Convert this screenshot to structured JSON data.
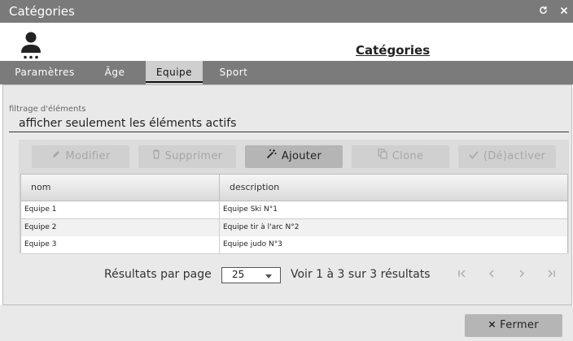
{
  "window": {
    "title": "Catégories",
    "refresh_icon": "refresh-icon",
    "close_icon": "close-icon"
  },
  "header": {
    "heading": "Catégories",
    "avatar_icon": "user-avatar-icon"
  },
  "tabs": [
    {
      "label": "Paramètres"
    },
    {
      "label": "Âge"
    },
    {
      "label": "Equipe",
      "active": true
    },
    {
      "label": "Sport"
    }
  ],
  "filter": {
    "label": "filtrage d'éléments",
    "value": "afficher seulement les éléments actifs"
  },
  "toolbar": {
    "modify": {
      "label": "Modifier",
      "icon": "pencil-icon",
      "enabled": false
    },
    "delete": {
      "label": "Supprimer",
      "icon": "trash-icon",
      "enabled": false
    },
    "add": {
      "label": "Ajouter",
      "icon": "magic-wand-icon",
      "enabled": true
    },
    "clone": {
      "label": "Clone",
      "icon": "copy-icon",
      "enabled": false
    },
    "toggle": {
      "label": "(Dé)activer",
      "icon": "check-icon",
      "enabled": false
    }
  },
  "table": {
    "columns": [
      "nom",
      "description"
    ],
    "rows": [
      [
        "Equipe 1",
        "Equipe Ski N°1"
      ],
      [
        "Equipe 2",
        "Equipe tir à l'arc N°2"
      ],
      [
        "Equipe 3",
        "Equipe judo N°3"
      ]
    ]
  },
  "pagination": {
    "per_page_label": "Résultats par page",
    "per_page_value": "25",
    "summary": "Voir 1 à 3 sur 3 résultats"
  },
  "footer": {
    "close_label": "Fermer",
    "close_icon": "close-icon"
  }
}
